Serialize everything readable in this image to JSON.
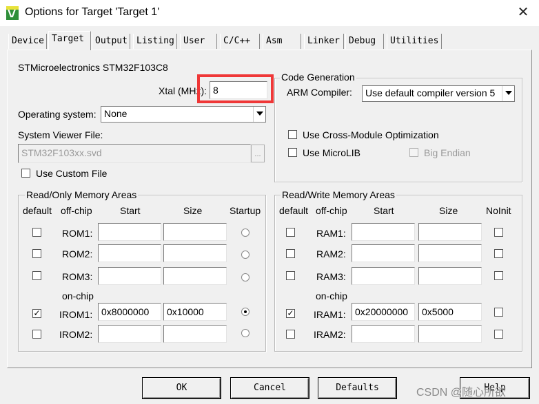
{
  "window": {
    "title": "Options for Target 'Target 1'",
    "close_glyph": "✕",
    "icon": "keil-uvision-icon"
  },
  "tabs": [
    {
      "label": "Device"
    },
    {
      "label": "Target"
    },
    {
      "label": "Output"
    },
    {
      "label": "Listing"
    },
    {
      "label": "User"
    },
    {
      "label": "C/C++"
    },
    {
      "label": "Asm"
    },
    {
      "label": "Linker"
    },
    {
      "label": "Debug"
    },
    {
      "label": "Utilities"
    }
  ],
  "active_tab": "Target",
  "target": {
    "device_name": "STMicroelectronics STM32F103C8",
    "xtal_label": "Xtal (MHz):",
    "xtal_value": "8",
    "os_label": "Operating system:",
    "os_value": "None",
    "svd_label": "System Viewer File:",
    "svd_value": "STM32F103xx.svd",
    "browse_label": "...",
    "custom_file_label": "Use Custom File",
    "custom_file_checked": false
  },
  "code_generation": {
    "title": "Code Generation",
    "compiler_label": "ARM Compiler:",
    "compiler_value": "Use default compiler version 5",
    "cross_module_label": "Use Cross-Module Optimization",
    "cross_module_checked": false,
    "microlib_label": "Use MicroLIB",
    "microlib_checked": false,
    "big_endian_label": "Big Endian",
    "big_endian_checked": false
  },
  "rom_areas": {
    "title": "Read/Only Memory Areas",
    "headers": {
      "default": "default",
      "offchip": "off-chip",
      "start": "Start",
      "size": "Size",
      "startup": "Startup"
    },
    "onchip_label": "on-chip",
    "rows": [
      {
        "label": "ROM1:",
        "default": false,
        "start": "",
        "size": "",
        "startup": false
      },
      {
        "label": "ROM2:",
        "default": false,
        "start": "",
        "size": "",
        "startup": false
      },
      {
        "label": "ROM3:",
        "default": false,
        "start": "",
        "size": "",
        "startup": false
      },
      {
        "label": "IROM1:",
        "default": true,
        "start": "0x8000000",
        "size": "0x10000",
        "startup": true
      },
      {
        "label": "IROM2:",
        "default": false,
        "start": "",
        "size": "",
        "startup": false
      }
    ]
  },
  "ram_areas": {
    "title": "Read/Write Memory Areas",
    "headers": {
      "default": "default",
      "offchip": "off-chip",
      "start": "Start",
      "size": "Size",
      "noinit": "NoInit"
    },
    "onchip_label": "on-chip",
    "rows": [
      {
        "label": "RAM1:",
        "default": false,
        "start": "",
        "size": "",
        "noinit": false
      },
      {
        "label": "RAM2:",
        "default": false,
        "start": "",
        "size": "",
        "noinit": false
      },
      {
        "label": "RAM3:",
        "default": false,
        "start": "",
        "size": "",
        "noinit": false
      },
      {
        "label": "IRAM1:",
        "default": true,
        "start": "0x20000000",
        "size": "0x5000",
        "noinit": false
      },
      {
        "label": "IRAM2:",
        "default": false,
        "start": "",
        "size": "",
        "noinit": false
      }
    ]
  },
  "buttons": {
    "ok": "OK",
    "cancel": "Cancel",
    "defaults": "Defaults",
    "help": "Help"
  },
  "watermark": "CSDN @随心所欲",
  "colors": {
    "highlight": "#ef3737",
    "dialog_bg": "#f0f0f0",
    "disabled_text": "#9a9a9a"
  }
}
